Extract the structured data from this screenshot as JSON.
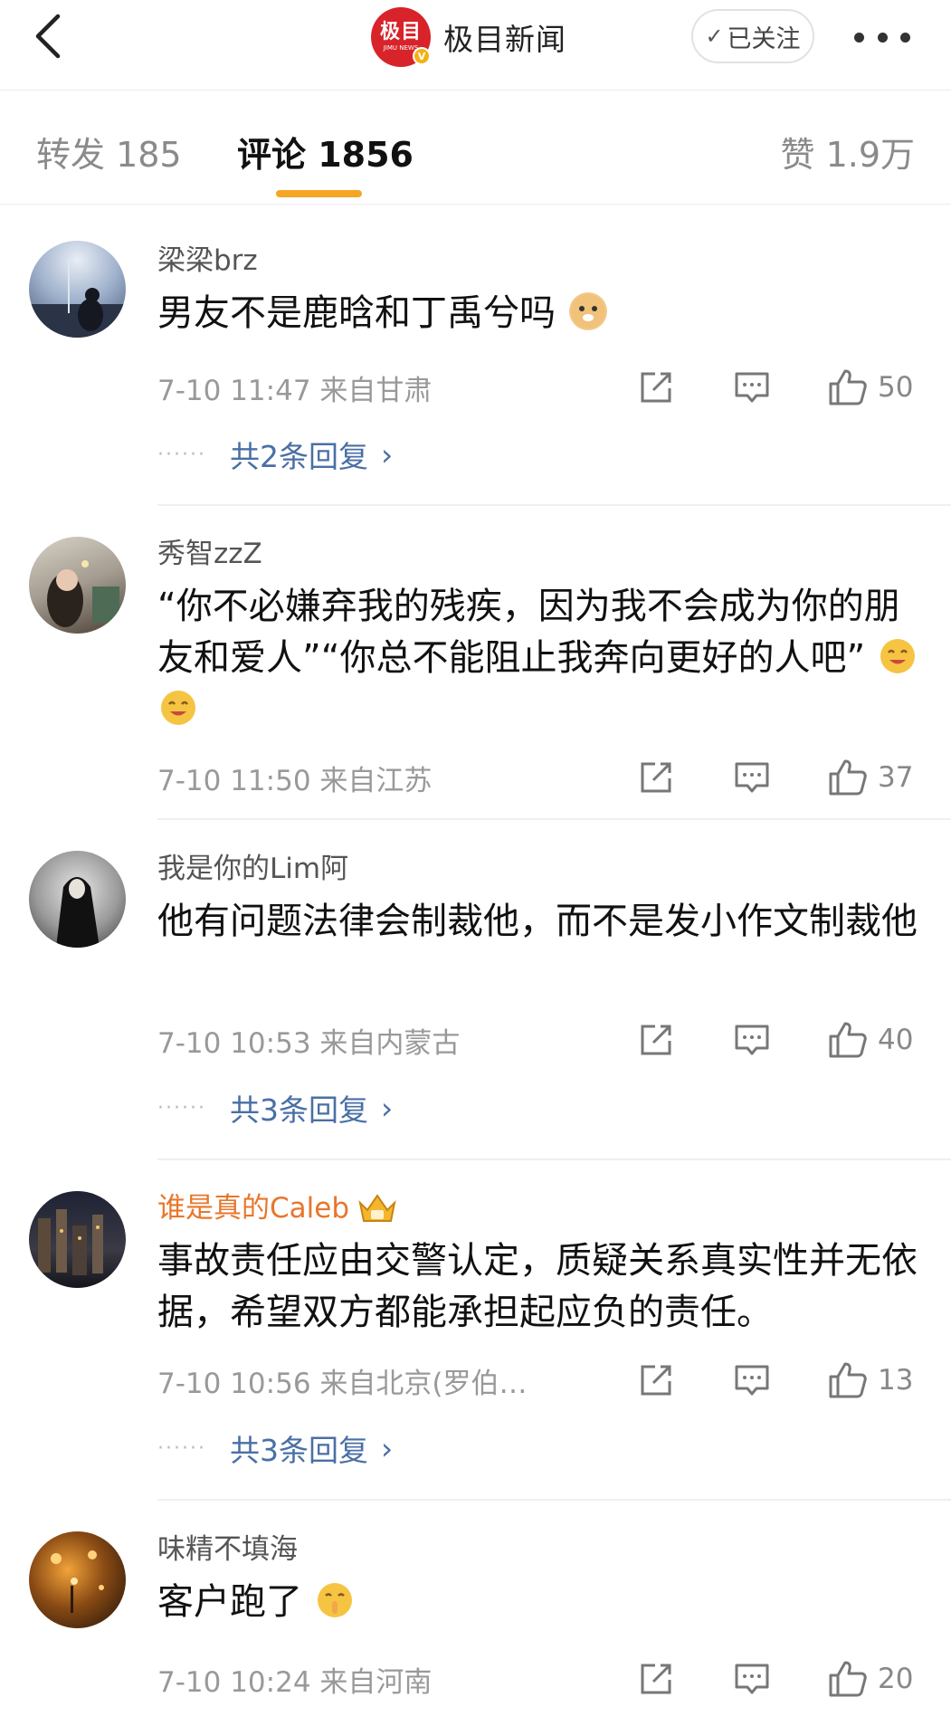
{
  "header": {
    "back_icon": "chevron-left-icon",
    "brand_logo_text": "极目",
    "brand_logo_sub": "JIMU NEWS",
    "brand_name": "极目新闻",
    "follow_label": "已关注",
    "more_icon": "more-dots-icon"
  },
  "tabs": {
    "forward": "转发 185",
    "comment": "评论 1856",
    "like": "赞 1.9万"
  },
  "comments": [
    {
      "username": "梁梁brz",
      "text": "男友不是鹿晗和丁禹兮吗",
      "emoji": "doge-emoji",
      "time": "7-10 11:47  来自甘肃",
      "likes": "50",
      "replies_label": "共2条回复"
    },
    {
      "username": "秀智zzZ",
      "text": "“你不必嫌弃我的残疾，因为我不会成为你的朋友和爱人”“你总不能阻止我奔向更好的人吧”",
      "emoji": "smile-emoji",
      "time": "7-10 11:50  来自江苏",
      "likes": "37"
    },
    {
      "username": "我是你的Lim阿",
      "text": "他有问题法律会制裁他，而不是发小作文制裁他",
      "time": "7-10 10:53  来自内蒙古",
      "likes": "40",
      "replies_label": "共3条回复"
    },
    {
      "username": "谁是真的Caleb",
      "text": "事故责任应由交警认定，质疑关系真实性并无依据，希望双方都能承担起应负的责任。",
      "time": "7-10 10:56  来自北京(罗伯…",
      "likes": "13",
      "replies_label": "共3条回复",
      "badge": "crown-icon"
    },
    {
      "username": "味精不填海",
      "text": "客户跑了",
      "emoji": "shush-emoji",
      "time": "7-10 10:24  来自河南",
      "likes": "20"
    }
  ],
  "colors": {
    "accent": "#f5a623",
    "link": "#4a6fa5",
    "vip_name": "#e8762b",
    "brand": "#d8232a"
  }
}
